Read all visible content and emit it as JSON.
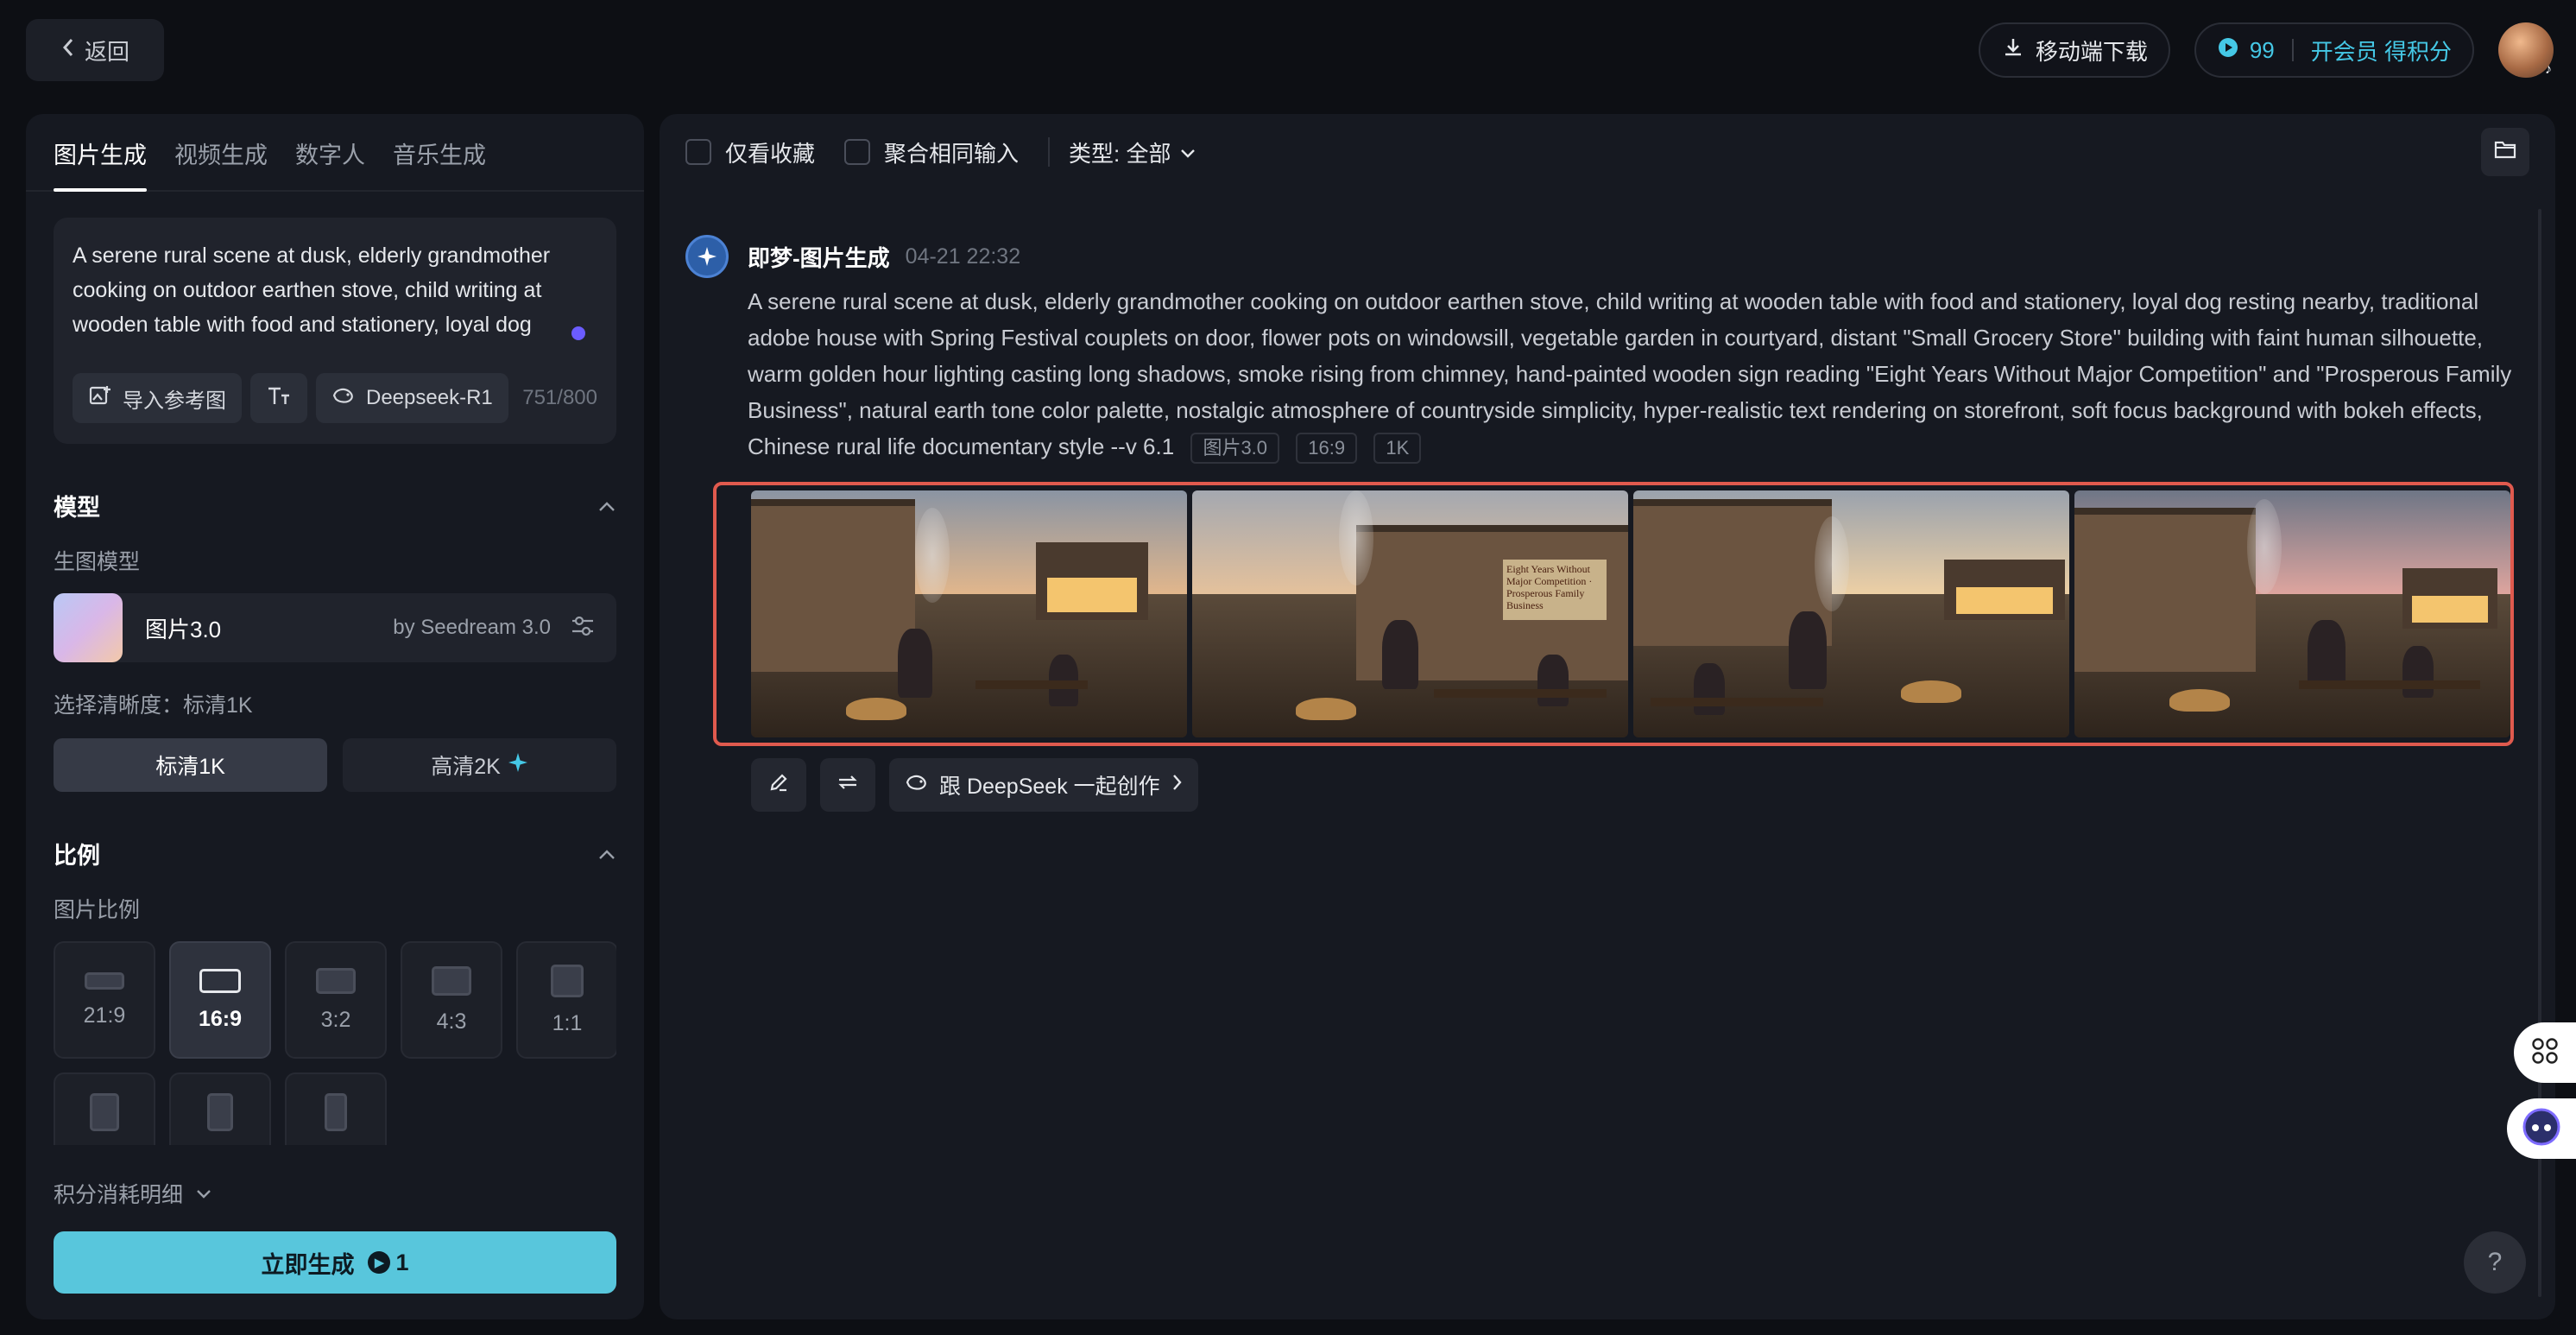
{
  "header": {
    "back_label": "返回",
    "download_label": "移动端下载",
    "points": "99",
    "vip_label": "开会员 得积分"
  },
  "left": {
    "tabs": [
      "图片生成",
      "视频生成",
      "数字人",
      "音乐生成"
    ],
    "prompt": "A serene rural scene at dusk, elderly grandmother cooking on outdoor earthen stove, child writing at wooden table with food and stationery, loyal dog resting nearby",
    "import_ref_label": "导入参考图",
    "deepseek_label": "Deepseek-R1",
    "counter": "751/800",
    "model_section": "模型",
    "model_sub": "生图模型",
    "model_name": "图片3.0",
    "model_by": "by Seedream 3.0",
    "resolution_label": "选择清晰度：标清1K",
    "res_options": [
      "标清1K",
      "高清2K"
    ],
    "ratio_section": "比例",
    "ratio_sub": "图片比例",
    "ratios": [
      "21:9",
      "16:9",
      "3:2",
      "4:3",
      "1:1",
      "",
      "",
      ""
    ],
    "cost_label": "积分消耗明细",
    "generate_label": "立即生成",
    "generate_cost": "1"
  },
  "right": {
    "filter_fav": "仅看收藏",
    "filter_merge": "聚合相同输入",
    "type_label": "类型: 全部",
    "source": "即梦-图片生成",
    "time": "04-21  22:32",
    "prompt": "A serene rural scene at dusk, elderly grandmother cooking on outdoor earthen stove, child writing at wooden table with food and stationery, loyal dog resting nearby, traditional adobe house with Spring Festival couplets on door, flower pots on windowsill, vegetable garden in courtyard, distant \"Small Grocery Store\" building with faint human silhouette, warm golden hour lighting casting long shadows, smoke rising from chimney, hand-painted wooden sign reading \"Eight Years Without Major Competition\" and \"Prosperous Family Business\", natural earth tone color palette, nostalgic atmosphere of countryside simplicity, hyper-realistic text rendering on storefront, soft focus background with bokeh effects, Chinese rural life documentary style --v 6.1",
    "tags": [
      "图片3.0",
      "16:9",
      "1K"
    ],
    "sign_text": "Eight Years Without Major Competition · Prosperous Family Business",
    "deepseek_action": "跟 DeepSeek 一起创作"
  },
  "help_label": "?"
}
